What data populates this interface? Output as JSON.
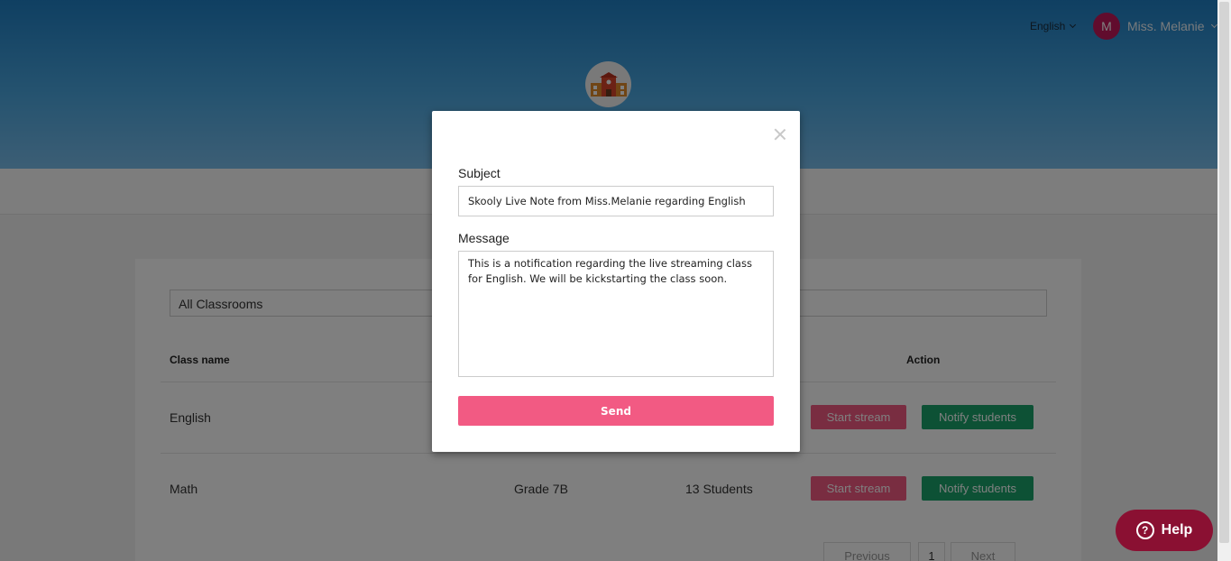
{
  "header": {
    "language": "English",
    "user": {
      "initial": "M",
      "name": "Miss. Melanie"
    }
  },
  "classes": {
    "filter": "All Classrooms",
    "columns": {
      "class_name": "Class name",
      "action": "Action"
    },
    "rows": [
      {
        "name": "English",
        "grade": "",
        "students": "",
        "start_label": "Start stream",
        "notify_label": "Notify students"
      },
      {
        "name": "Math",
        "grade": "Grade 7B",
        "students": "13 Students",
        "start_label": "Start stream",
        "notify_label": "Notify students"
      }
    ],
    "pagination": {
      "previous": "Previous",
      "page": "1",
      "next": "Next"
    }
  },
  "modal": {
    "subject_label": "Subject",
    "subject_value": "Skooly Live Note from Miss.Melanie regarding English",
    "message_label": "Message",
    "message_value": "This is a notification regarding the live streaming class for English. We will be kickstarting the class soon.",
    "send_label": "Send"
  },
  "help": {
    "icon": "?",
    "label": "Help"
  },
  "colors": {
    "stream": "#f25a83",
    "notify": "#1aa36b",
    "avatar": "#c2185b",
    "help": "#8a1032"
  }
}
